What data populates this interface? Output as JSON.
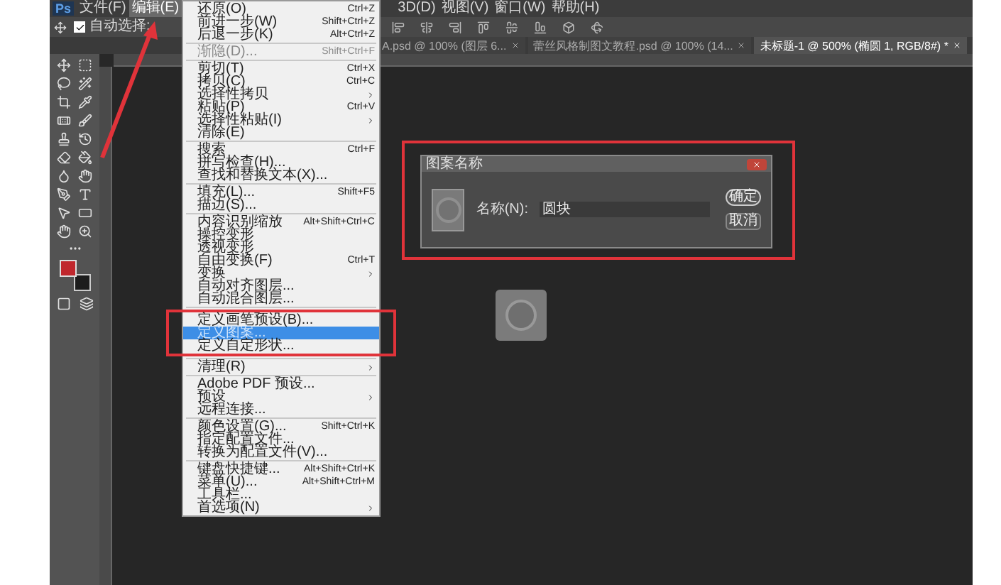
{
  "app_logo": "Ps",
  "menu_bar": [
    {
      "label": "文件(F)",
      "selected": false
    },
    {
      "label": "编辑(E)",
      "selected": true
    },
    {
      "label": "3D(D)",
      "selected": false
    },
    {
      "label": "视图(V)",
      "selected": false
    },
    {
      "label": "窗口(W)",
      "selected": false
    },
    {
      "label": "帮助(H)",
      "selected": false
    }
  ],
  "options_bar": {
    "auto_select_label": "自动选择:",
    "auto_select_checked": true
  },
  "tabs": [
    {
      "label": "A.psd @ 100% (图层 6...",
      "selected": false
    },
    {
      "label": "蕾丝风格制图文教程.psd @ 100% (14...",
      "selected": false
    },
    {
      "label": "未标题-1 @ 500% (椭圆 1, RGB/8#) *",
      "selected": true
    }
  ],
  "edit_menu": [
    {
      "kind": "item",
      "label": "还原(O)",
      "shortcut": "Ctrl+Z",
      "submenu": false,
      "selected": false,
      "disabled": false
    },
    {
      "kind": "item",
      "label": "前进一步(W)",
      "shortcut": "Shift+Ctrl+Z",
      "submenu": false,
      "selected": false,
      "disabled": false
    },
    {
      "kind": "item",
      "label": "后退一步(K)",
      "shortcut": "Alt+Ctrl+Z",
      "submenu": false,
      "selected": false,
      "disabled": false
    },
    {
      "kind": "separator"
    },
    {
      "kind": "item",
      "label": "渐隐(D)...",
      "shortcut": "Shift+Ctrl+F",
      "submenu": false,
      "selected": false,
      "disabled": true
    },
    {
      "kind": "separator"
    },
    {
      "kind": "item",
      "label": "剪切(T)",
      "shortcut": "Ctrl+X",
      "submenu": false,
      "selected": false,
      "disabled": false
    },
    {
      "kind": "item",
      "label": "拷贝(C)",
      "shortcut": "Ctrl+C",
      "submenu": false,
      "selected": false,
      "disabled": false
    },
    {
      "kind": "item",
      "label": "选择性拷贝",
      "submenu": true,
      "selected": false,
      "disabled": false
    },
    {
      "kind": "item",
      "label": "粘贴(P)",
      "shortcut": "Ctrl+V",
      "submenu": false,
      "selected": false,
      "disabled": false
    },
    {
      "kind": "item",
      "label": "选择性粘贴(I)",
      "submenu": true,
      "selected": false,
      "disabled": false
    },
    {
      "kind": "item",
      "label": "清除(E)",
      "submenu": false,
      "selected": false,
      "disabled": false
    },
    {
      "kind": "separator"
    },
    {
      "kind": "item",
      "label": "搜索",
      "shortcut": "Ctrl+F",
      "submenu": false,
      "selected": false,
      "disabled": false
    },
    {
      "kind": "item",
      "label": "拼写检查(H)...",
      "submenu": false,
      "selected": false,
      "disabled": false
    },
    {
      "kind": "item",
      "label": "查找和替换文本(X)...",
      "submenu": false,
      "selected": false,
      "disabled": false
    },
    {
      "kind": "separator"
    },
    {
      "kind": "item",
      "label": "填充(L)...",
      "shortcut": "Shift+F5",
      "submenu": false,
      "selected": false,
      "disabled": false
    },
    {
      "kind": "item",
      "label": "描边(S)...",
      "submenu": false,
      "selected": false,
      "disabled": false
    },
    {
      "kind": "separator"
    },
    {
      "kind": "item",
      "label": "内容识别缩放",
      "shortcut": "Alt+Shift+Ctrl+C",
      "submenu": false,
      "selected": false,
      "disabled": false
    },
    {
      "kind": "item",
      "label": "操控变形",
      "submenu": false,
      "selected": false,
      "disabled": false
    },
    {
      "kind": "item",
      "label": "透视变形",
      "submenu": false,
      "selected": false,
      "disabled": false
    },
    {
      "kind": "item",
      "label": "自由变换(F)",
      "shortcut": "Ctrl+T",
      "submenu": false,
      "selected": false,
      "disabled": false
    },
    {
      "kind": "item",
      "label": "变换",
      "submenu": true,
      "selected": false,
      "disabled": false
    },
    {
      "kind": "item",
      "label": "自动对齐图层...",
      "submenu": false,
      "selected": false,
      "disabled": false
    },
    {
      "kind": "item",
      "label": "自动混合图层...",
      "submenu": false,
      "selected": false,
      "disabled": false
    },
    {
      "kind": "separator"
    },
    {
      "kind": "item",
      "label": "定义画笔预设(B)...",
      "submenu": false,
      "selected": false,
      "disabled": false
    },
    {
      "kind": "item",
      "label": "定义图案...",
      "submenu": false,
      "selected": true,
      "disabled": false
    },
    {
      "kind": "item",
      "label": "定义自定形状...",
      "submenu": false,
      "selected": false,
      "disabled": false
    },
    {
      "kind": "separator"
    },
    {
      "kind": "item",
      "label": "清理(R)",
      "submenu": true,
      "selected": false,
      "disabled": false
    },
    {
      "kind": "separator"
    },
    {
      "kind": "item",
      "label": "Adobe PDF 预设...",
      "submenu": false,
      "selected": false,
      "disabled": false
    },
    {
      "kind": "item",
      "label": "预设",
      "submenu": true,
      "selected": false,
      "disabled": false
    },
    {
      "kind": "item",
      "label": "远程连接...",
      "submenu": false,
      "selected": false,
      "disabled": false
    },
    {
      "kind": "separator"
    },
    {
      "kind": "item",
      "label": "颜色设置(G)...",
      "shortcut": "Shift+Ctrl+K",
      "submenu": false,
      "selected": false,
      "disabled": false
    },
    {
      "kind": "item",
      "label": "指定配置文件...",
      "submenu": false,
      "selected": false,
      "disabled": false
    },
    {
      "kind": "item",
      "label": "转换为配置文件(V)...",
      "submenu": false,
      "selected": false,
      "disabled": false
    },
    {
      "kind": "separator"
    },
    {
      "kind": "item",
      "label": "键盘快捷键...",
      "shortcut": "Alt+Shift+Ctrl+K",
      "submenu": false,
      "selected": false,
      "disabled": false
    },
    {
      "kind": "item",
      "label": "菜单(U)...",
      "shortcut": "Alt+Shift+Ctrl+M",
      "submenu": false,
      "selected": false,
      "disabled": false
    },
    {
      "kind": "item",
      "label": "工具栏...",
      "submenu": false,
      "selected": false,
      "disabled": false
    },
    {
      "kind": "item",
      "label": "首选项(N)",
      "submenu": true,
      "selected": false,
      "disabled": false
    }
  ],
  "dialog": {
    "title": "图案名称",
    "name_label": "名称(N):",
    "name_value": "圆块",
    "ok": "确定",
    "cancel": "取消"
  }
}
